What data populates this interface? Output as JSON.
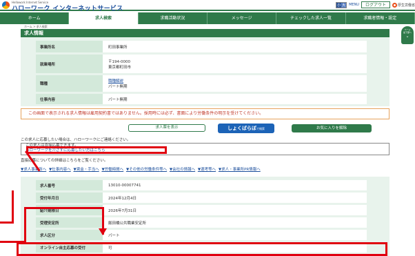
{
  "header": {
    "logo_en": "Hellowork Internet Service",
    "logo_jp": "ハローワーク インターネットサービス",
    "font_size_small": "小",
    "font_size_large": "大",
    "menu_label": "MENU",
    "logout_label": "ログアウト",
    "ministry_label": "厚生労働省"
  },
  "nav": {
    "items": [
      {
        "label": "ホーム"
      },
      {
        "label": "求人検索"
      },
      {
        "label": "求職活動状況"
      },
      {
        "label": "メッセージ"
      },
      {
        "label": "チェックした求人一覧"
      },
      {
        "label": "求職者情報・設定"
      }
    ]
  },
  "breadcrumb": "ホーム > 求人検索",
  "page_title": "求人情報",
  "float_button": {
    "line1": "ページ",
    "line2": "最下部へ",
    "chevron": "⌄"
  },
  "summary": {
    "rows": [
      {
        "th": "事業所名",
        "td": [
          "町田事業所"
        ]
      },
      {
        "th": "就業場所",
        "td": [
          "〒194-0000",
          "東京都町田市"
        ]
      },
      {
        "th": "職種",
        "td_link": "職種解説",
        "td": [
          "パート無期"
        ]
      },
      {
        "th": "仕事内容",
        "td": [
          "パート無期"
        ]
      }
    ]
  },
  "notice": "この画面で表示される求人情報は雇用契約書ではありません。採用時には必ず、書面により労働条件の明示を受けてください。",
  "actions": {
    "show_job_label": "求人票を表示",
    "shokubaraboo_label": "しょくばらぼ",
    "shokubaraboo_search_label": "で検索",
    "remove_favorite_label": "お気に入りを解除"
  },
  "contact_line": "この求人に応募したい場合は、ハローワークにご連絡ください。",
  "info_box": {
    "line1": "この求人は直接応募できます。",
    "line2": "ハローワークを介さずに応募したい方はこちら"
  },
  "detail_line": "直接応募についての詳細はこちらをご覧ください。",
  "anchor_links": [
    "▼求人事業所へ",
    "▼仕事内容へ",
    "▼賃金・手当へ",
    "▼労働時間へ",
    "▼その他の労働条件等へ",
    "▼会社の情報へ",
    "▼選考等へ",
    "▼求人・事業所PR情報へ"
  ],
  "detail": {
    "rows": [
      {
        "th": "求人番号",
        "td": "13010-00007741"
      },
      {
        "th": "受付年月日",
        "td": "2024年12月4日"
      },
      {
        "th": "紹介期限日",
        "td": "2026年7月31日"
      },
      {
        "th": "受理安定所",
        "td": "飯田橋公共職業安定所"
      },
      {
        "th": "求人区分",
        "td": "パート"
      },
      {
        "th": "オンライン自主応募の受付",
        "td": "可"
      }
    ]
  }
}
